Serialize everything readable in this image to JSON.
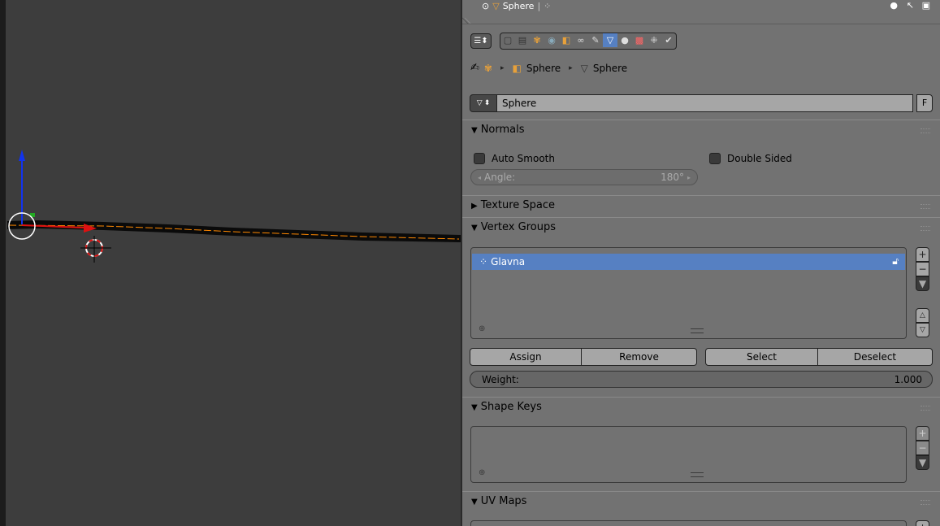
{
  "header": {
    "object_name": "Sphere",
    "mesh_icon": "mesh-data-icon",
    "vertex_icon": "vertex-group-icon"
  },
  "context_tabs": {
    "editor_type_icon": "properties-editor-icon",
    "tabs": [
      "render-icon",
      "render-layers-icon",
      "scene-icon",
      "world-icon",
      "object-icon",
      "constraints-icon",
      "modifiers-icon",
      "mesh-data-icon",
      "material-icon",
      "texture-icon",
      "particles-icon",
      "physics-icon"
    ],
    "active_index": 7
  },
  "breadcrumb": {
    "pin_icon": "pin-icon",
    "scene_icon": "scene-icon",
    "object": "Sphere",
    "mesh": "Sphere"
  },
  "datablock": {
    "name": "Sphere",
    "fake_user": "F"
  },
  "panels": {
    "normals": "Normals",
    "texture_space": "Texture Space",
    "vertex_groups": "Vertex Groups",
    "shape_keys": "Shape Keys",
    "uv_maps": "UV Maps"
  },
  "normals": {
    "auto_smooth": "Auto Smooth",
    "double_sided": "Double Sided",
    "angle_label": "Angle:",
    "angle_value": "180°"
  },
  "vertex_groups": {
    "items": [
      {
        "name": "Glavna",
        "locked": false
      }
    ],
    "assign": "Assign",
    "remove": "Remove",
    "select": "Select",
    "deselect": "Deselect",
    "weight_label": "Weight:",
    "weight_value": "1.000"
  },
  "colors": {
    "panel_bg": "#727272",
    "viewport_bg": "#3d3d3d",
    "accent": "#5680c2",
    "x_axis": "#dd1111",
    "y_axis": "#22aa22",
    "z_axis": "#1133ee",
    "edge_highlight": "#ff8800"
  }
}
